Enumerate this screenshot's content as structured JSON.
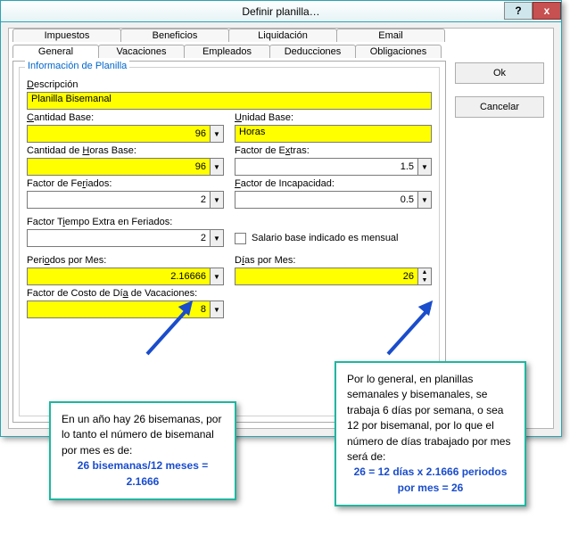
{
  "window": {
    "title": "Definir planilla…",
    "help_icon": "?",
    "close_icon": "x"
  },
  "tabs_row1": [
    {
      "label": "Impuestos"
    },
    {
      "label": "Beneficios"
    },
    {
      "label": "Liquidación"
    },
    {
      "label": "Email"
    }
  ],
  "tabs_row2": [
    {
      "label": "General"
    },
    {
      "label": "Vacaciones"
    },
    {
      "label": "Empleados"
    },
    {
      "label": "Deducciones"
    },
    {
      "label": "Obligaciones"
    }
  ],
  "buttons": {
    "ok": "Ok",
    "cancel": "Cancelar"
  },
  "group": {
    "legend": "Información de Planilla"
  },
  "fields": {
    "descripcion": {
      "label_pre": "",
      "label_u": "D",
      "label_post": "escripción",
      "value": "Planilla Bisemanal"
    },
    "cantidad_base": {
      "label_pre": "",
      "label_u": "C",
      "label_post": "antidad Base:",
      "value": "96"
    },
    "unidad_base": {
      "label_pre": "",
      "label_u": "U",
      "label_post": "nidad Base:",
      "value": "Horas"
    },
    "cant_horas": {
      "label_pre": "Cantidad de ",
      "label_u": "H",
      "label_post": "oras Base:",
      "value": "96"
    },
    "factor_extras": {
      "label_pre": "Factor de E",
      "label_u": "x",
      "label_post": "tras:",
      "value": "1.5"
    },
    "factor_feriados": {
      "label_pre": "Factor de Fe",
      "label_u": "r",
      "label_post": "iados:",
      "value": "2"
    },
    "factor_incap": {
      "label_pre": "",
      "label_u": "F",
      "label_post": "actor de Incapacidad:",
      "value": "0.5"
    },
    "factor_tiempo": {
      "label_pre": "Factor T",
      "label_u": "i",
      "label_post": "empo Extra en Feriados:",
      "value": "2"
    },
    "salario_mensual": {
      "label_pre": "",
      "label_u": "S",
      "label_post": "alario base indicado es mensual",
      "checked": false
    },
    "periodos_mes": {
      "label_pre": "Peri",
      "label_u": "o",
      "label_post": "dos por Mes:",
      "value": "2.16666"
    },
    "dias_mes": {
      "label_pre": "D",
      "label_u": "í",
      "label_post": "as por Mes:",
      "value": "26"
    },
    "factor_vac": {
      "label_pre": "Factor de Costo de Dí",
      "label_u": "a",
      "label_post": " de Vacaciones:",
      "value": "8"
    }
  },
  "callouts": {
    "left": {
      "text": "En un año hay 26 bisemanas, por lo tanto el número de bisemanal por mes es de:",
      "emph": "26 bisemanas/12 meses = 2.1666"
    },
    "right": {
      "text": "Por lo general, en planillas semanales y bisemanales, se trabaja 6 días por semana, o sea 12 por bisemanal, por lo que el número de días trabajado por mes será de:",
      "emph": "26 = 12 días x 2.1666 periodos por mes = 26"
    }
  }
}
